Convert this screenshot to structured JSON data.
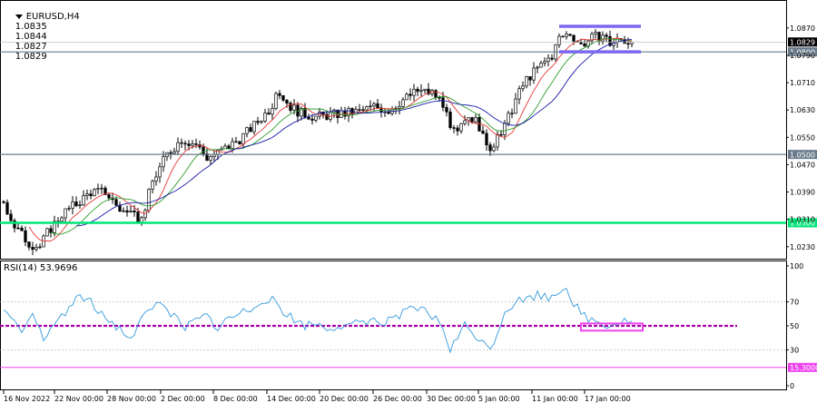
{
  "header": {
    "symbol": "EURUSD,H4",
    "open": "1.0835",
    "high": "1.0844",
    "low": "1.0827",
    "close": "1.0829"
  },
  "colors": {
    "background": "#ffffff",
    "candle": "#000000",
    "ma_fast": "#e53935",
    "ma_mid": "#2e9e2e",
    "ma_slow": "#1a1aa8",
    "support_line": "#00e676",
    "level_line": "#6a7b8c",
    "channel": "#7b68ee",
    "rsi_line": "#3399dd",
    "rsi_mid": "#aa00aa",
    "rsi_box": "#ee44ee",
    "rsi_low_line": "#ee44ee"
  },
  "chart_data": [
    {
      "type": "candlestick",
      "symbol": "EURUSD",
      "timeframe": "H4",
      "ylim": [
        1.0195,
        1.092
      ],
      "y_ticks": [
        "1.0870",
        "1.0790",
        "1.0710",
        "1.0630",
        "1.0550",
        "1.0470",
        "1.0390",
        "1.0310",
        "1.0230"
      ],
      "x_ticks": [
        "16 Nov 2022",
        "22 Nov 00:00",
        "28 Nov 00:00",
        "2 Dec 00:00",
        "8 Dec 00:00",
        "14 Dec 00:00",
        "20 Dec 00:00",
        "26 Dec 00:00",
        "30 Dec 00:00",
        "5 Jan 00:00",
        "11 Jan 00:00",
        "17 Jan 00:00"
      ],
      "last_price": "1.0829",
      "horizontal_levels": [
        {
          "price": 1.08,
          "label": "1.0800",
          "style": "gray"
        },
        {
          "price": 1.05,
          "label": "1.0500",
          "style": "gray"
        },
        {
          "price": 1.03,
          "label": "1.0300",
          "style": "green"
        }
      ],
      "channel": {
        "start_date": "12 Jan",
        "end_date": "19 Jan",
        "upper": 1.0875,
        "lower": 1.08
      },
      "anchors": [
        [
          0,
          1.0362
        ],
        [
          3,
          1.029
        ],
        [
          7,
          1.024
        ],
        [
          10,
          1.023
        ],
        [
          12,
          1.027
        ],
        [
          16,
          1.0325
        ],
        [
          20,
          1.0355
        ],
        [
          24,
          1.039
        ],
        [
          28,
          1.039
        ],
        [
          32,
          1.034
        ],
        [
          35,
          1.032
        ],
        [
          38,
          1.031
        ],
        [
          41,
          1.042
        ],
        [
          45,
          1.05
        ],
        [
          49,
          1.0545
        ],
        [
          53,
          1.053
        ],
        [
          56,
          1.049
        ],
        [
          60,
          1.051
        ],
        [
          65,
          1.0545
        ],
        [
          69,
          1.0585
        ],
        [
          73,
          1.063
        ],
        [
          76,
          1.068
        ],
        [
          79,
          1.064
        ],
        [
          82,
          1.062
        ],
        [
          86,
          1.061
        ],
        [
          90,
          1.0615
        ],
        [
          94,
          1.062
        ],
        [
          98,
          1.0625
        ],
        [
          102,
          1.064
        ],
        [
          106,
          1.063
        ],
        [
          110,
          1.066
        ],
        [
          114,
          1.0685
        ],
        [
          118,
          1.068
        ],
        [
          121,
          1.065
        ],
        [
          123,
          1.057
        ],
        [
          125,
          1.056
        ],
        [
          128,
          1.062
        ],
        [
          131,
          1.058
        ],
        [
          133,
          1.052
        ],
        [
          135,
          1.0525
        ],
        [
          138,
          1.058
        ],
        [
          141,
          1.066
        ],
        [
          144,
          1.072
        ],
        [
          148,
          1.076
        ],
        [
          151,
          1.079
        ],
        [
          153,
          1.084
        ],
        [
          156,
          1.0855
        ],
        [
          159,
          1.082
        ],
        [
          162,
          1.084
        ],
        [
          165,
          1.085
        ],
        [
          167,
          1.0825
        ],
        [
          170,
          1.0835
        ],
        [
          173,
          1.0829
        ]
      ],
      "moving_averages": [
        {
          "period": 8,
          "color": "red"
        },
        {
          "period": 14,
          "color": "green"
        },
        {
          "period": 21,
          "color": "blue"
        }
      ]
    },
    {
      "type": "line",
      "name": "RSI(14)",
      "label": "RSI(14) 53.9696",
      "value": 53.9696,
      "ylim": [
        0,
        100
      ],
      "y_ticks": [
        "100",
        "70",
        "50",
        "30",
        "0"
      ],
      "levels": [
        {
          "value": 50,
          "label": "50"
        }
      ],
      "lower_marker": {
        "value": 15.3,
        "label": "15.3000"
      },
      "box": {
        "start_date": "12 Jan",
        "end_date": "15 Jan",
        "upper": 52,
        "lower": 46
      },
      "anchors": [
        [
          0,
          60
        ],
        [
          3,
          52
        ],
        [
          6,
          46
        ],
        [
          8,
          58
        ],
        [
          11,
          38
        ],
        [
          14,
          52
        ],
        [
          17,
          62
        ],
        [
          20,
          72
        ],
        [
          23,
          75
        ],
        [
          26,
          60
        ],
        [
          29,
          55
        ],
        [
          32,
          48
        ],
        [
          35,
          40
        ],
        [
          38,
          55
        ],
        [
          41,
          66
        ],
        [
          44,
          70
        ],
        [
          47,
          57
        ],
        [
          50,
          50
        ],
        [
          53,
          54
        ],
        [
          56,
          58
        ],
        [
          59,
          48
        ],
        [
          62,
          56
        ],
        [
          65,
          60
        ],
        [
          68,
          64
        ],
        [
          71,
          72
        ],
        [
          74,
          74
        ],
        [
          77,
          62
        ],
        [
          80,
          55
        ],
        [
          83,
          50
        ],
        [
          86,
          52
        ],
        [
          89,
          48
        ],
        [
          92,
          50
        ],
        [
          95,
          48
        ],
        [
          98,
          53
        ],
        [
          101,
          55
        ],
        [
          104,
          52
        ],
        [
          107,
          58
        ],
        [
          110,
          60
        ],
        [
          113,
          64
        ],
        [
          116,
          62
        ],
        [
          119,
          55
        ],
        [
          121,
          48
        ],
        [
          123,
          30
        ],
        [
          125,
          40
        ],
        [
          127,
          50
        ],
        [
          130,
          42
        ],
        [
          133,
          32
        ],
        [
          135,
          36
        ],
        [
          138,
          62
        ],
        [
          141,
          70
        ],
        [
          144,
          72
        ],
        [
          147,
          76
        ],
        [
          150,
          73
        ],
        [
          153,
          80
        ],
        [
          155,
          82
        ],
        [
          157,
          70
        ],
        [
          159,
          60
        ],
        [
          161,
          56
        ],
        [
          163,
          54
        ],
        [
          165,
          52
        ],
        [
          167,
          50
        ],
        [
          170,
          54
        ],
        [
          173,
          54
        ]
      ]
    }
  ]
}
